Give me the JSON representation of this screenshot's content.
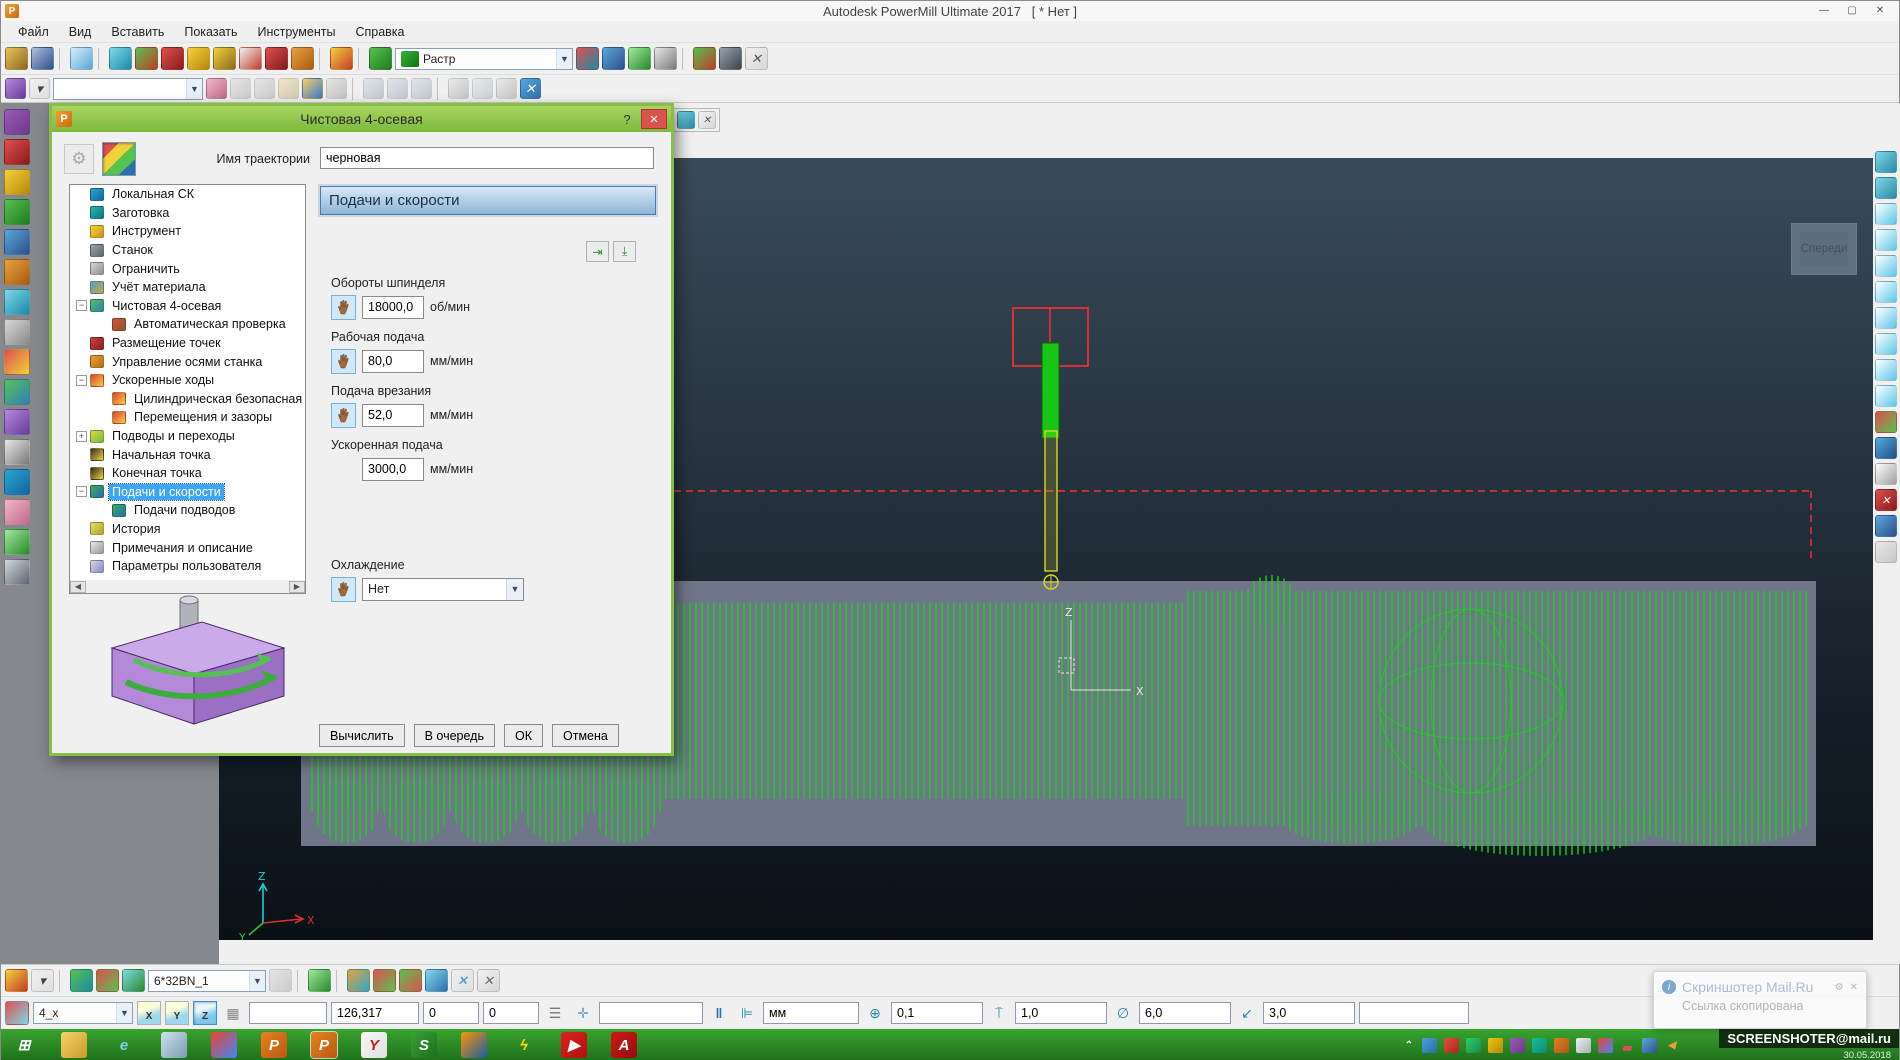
{
  "window": {
    "title": "Autodesk PowerMill Ultimate 2017",
    "title_suffix": "[ * Нет ]",
    "controls": {
      "minimize": "—",
      "maximize": "▢",
      "close": "✕"
    }
  },
  "menubar": {
    "items": [
      {
        "label": "Файл"
      },
      {
        "label": "Вид"
      },
      {
        "label": "Вставить"
      },
      {
        "label": "Показать"
      },
      {
        "label": "Инструменты"
      },
      {
        "label": "Справка"
      }
    ]
  },
  "toolbar_main": {
    "icons_left": [
      {
        "name": "open-project-icon",
        "c1": "#e8c35a",
        "c2": "#8a6a1f"
      },
      {
        "name": "save-project-icon",
        "c1": "#aebfd8",
        "c2": "#2f4f8f"
      },
      {
        "sep": true
      },
      {
        "name": "print-icon",
        "c1": "#d8eefc",
        "c2": "#58a8d8"
      },
      {
        "sep": true
      },
      {
        "name": "block-icon",
        "c1": "#7fd8e8",
        "c2": "#1a8aa8"
      },
      {
        "name": "create-toolpath-icon",
        "c1": "#58c24e",
        "c2": "#c43a2a"
      },
      {
        "name": "toolpath-edit-icon",
        "c1": "#e05050",
        "c2": "#8a1a1a"
      },
      {
        "name": "tool-icon",
        "c1": "#f2d23b",
        "c2": "#b8860b"
      },
      {
        "name": "tool-edit-icon",
        "c1": "#f2d23b",
        "c2": "#8a6a1f"
      },
      {
        "name": "pattern-icon",
        "c1": "#f0f0f0",
        "c2": "#c43a2a"
      },
      {
        "name": "points-icon",
        "c1": "#e05050",
        "c2": "#7e1a1a"
      },
      {
        "name": "boundary-icon",
        "c1": "#e8a23c",
        "c2": "#a85a14"
      },
      {
        "sep": true
      },
      {
        "name": "macro-icon",
        "c1": "#f2d23b",
        "c2": "#c43a2a"
      },
      {
        "sep": true
      },
      {
        "name": "simulation-icon",
        "c1": "#58c24e",
        "c2": "#1f7a1f"
      }
    ],
    "strategy_combo": {
      "value": "Растр",
      "icon_c1": "#35b435",
      "icon_c2": "#127012"
    },
    "icons_right": [
      {
        "name": "calculate-toolpath-icon",
        "c1": "#e05050",
        "c2": "#1a8aa8"
      },
      {
        "name": "statistics-icon",
        "c1": "#58a8d8",
        "c2": "#2f4f8f"
      },
      {
        "name": "nc-program-icon",
        "c1": "#9fe89f",
        "c2": "#2a8a2a"
      },
      {
        "name": "calculator-icon",
        "c1": "#e8e8e8",
        "c2": "#7a7a7a"
      },
      {
        "sep": true
      },
      {
        "name": "transform-icon",
        "c1": "#58c24e",
        "c2": "#c43a2a"
      },
      {
        "name": "find-icon",
        "c1": "#9aa4ad",
        "c2": "#3a444d"
      },
      {
        "name": "close-toolbar-icon",
        "glyph": "✕",
        "gc": "#555",
        "c1": "#f0f0f0",
        "c2": "#d8d8d8"
      }
    ]
  },
  "toolbar_second": {
    "icons_left": [
      {
        "name": "ncprogram-icon",
        "c1": "#b48ad8",
        "c2": "#6a3aa0"
      },
      {
        "name": "dropdown-arrow-icon",
        "glyph": "▾",
        "gc": "#444",
        "c1": "#f0f0f0",
        "c2": "#e0e0e0"
      }
    ],
    "combo_value": "",
    "icons_right": [
      {
        "name": "eraser-icon",
        "c1": "#f0b8c8",
        "c2": "#c06a8a"
      },
      {
        "name": "calc-nc-icon",
        "c1": "#d8d8d8",
        "c2": "#a0a0a0",
        "muted": true
      },
      {
        "name": "calc-all-icon",
        "c1": "#d8d8d8",
        "c2": "#a0a0a0",
        "muted": true
      },
      {
        "name": "levels-icon",
        "c1": "#e8d8a0",
        "c2": "#b0a060",
        "muted": true
      },
      {
        "name": "open-nc-icon",
        "c1": "#f4d06a",
        "c2": "#3a7ac8"
      },
      {
        "name": "save-nc-icon",
        "c1": "#d8d8d8",
        "c2": "#8a8a8a",
        "muted": true
      },
      {
        "sep": true
      },
      {
        "name": "workplane-a-icon",
        "c1": "#d0d8e0",
        "c2": "#8a98a8",
        "muted": true
      },
      {
        "name": "workplane-b-icon",
        "c1": "#d0d8e0",
        "c2": "#8a98a8",
        "muted": true
      },
      {
        "name": "workplane-c-icon",
        "c1": "#d0d8e0",
        "c2": "#8a98a8",
        "muted": true
      },
      {
        "sep": true
      },
      {
        "name": "grid-icon",
        "c1": "#e0e0e0",
        "c2": "#909090",
        "muted": true
      },
      {
        "name": "cloud-icon",
        "c1": "#e0e0e0",
        "c2": "#9ab0c0",
        "muted": true
      },
      {
        "name": "clip-icon",
        "c1": "#e0e0e0",
        "c2": "#909090",
        "muted": true
      },
      {
        "name": "close-second-toolbar-icon",
        "glyph": "✕",
        "gc": "#fff",
        "c1": "#58a8d8",
        "c2": "#2f6fae"
      }
    ]
  },
  "floating_fragment": {
    "icons": [
      {
        "name": "view-grid-icon",
        "c1": "#7fd8e8",
        "c2": "#2a8aa8"
      },
      {
        "name": "close-fragment-icon",
        "glyph": "✕",
        "gc": "#555",
        "c1": "#f0f0f0",
        "c2": "#d8d8d8"
      }
    ]
  },
  "left_toolbar": {
    "icons": [
      {
        "name": "explorer-purple-icon",
        "c1": "#9b59b6",
        "c2": "#6a3a8a"
      },
      {
        "name": "record-icon",
        "c1": "#e05050",
        "c2": "#8a1a1a"
      },
      {
        "name": "levels-manager-icon",
        "c1": "#f2d23b",
        "c2": "#b8860b"
      },
      {
        "name": "models-icon",
        "c1": "#58c24e",
        "c2": "#1f7a1f"
      },
      {
        "name": "workplane-tree-icon",
        "c1": "#58a8d8",
        "c2": "#2f4f8f"
      },
      {
        "name": "toolpath-tree-icon",
        "c1": "#e8a23c",
        "c2": "#a85a14"
      },
      {
        "name": "tools-tree-icon",
        "c1": "#7fd8e8",
        "c2": "#1a8aa8"
      },
      {
        "name": "boundary-tree-icon",
        "c1": "#d8d8d8",
        "c2": "#8a8a8a"
      },
      {
        "name": "pattern-tree-icon",
        "c1": "#e05050",
        "c2": "#f2d23b"
      },
      {
        "name": "feature-tree-icon",
        "c1": "#58c24e",
        "c2": "#2e7fc2"
      },
      {
        "name": "macro-tree-icon",
        "c1": "#b48ad8",
        "c2": "#6a3aa0"
      },
      {
        "name": "ncprogram-tree-icon",
        "c1": "#e8e8e8",
        "c2": "#7a7a7a"
      },
      {
        "name": "stock-model-icon",
        "c1": "#2aa7c9",
        "c2": "#1463a8"
      },
      {
        "name": "groups-icon",
        "c1": "#f0b8c8",
        "c2": "#c06a8a"
      },
      {
        "name": "simulation-tree-icon",
        "c1": "#9fe89f",
        "c2": "#2a8a2a"
      },
      {
        "name": "collision-icon",
        "c1": "#d0d8e0",
        "c2": "#5c666e"
      }
    ]
  },
  "right_toolbar": {
    "icons": [
      {
        "name": "view-table-icon",
        "c1": "#7fd8e8",
        "c2": "#2a8aa8"
      },
      {
        "name": "view-table2-icon",
        "c1": "#7fd8e8",
        "c2": "#2a8aa8"
      },
      {
        "name": "view-iso1-icon",
        "c1": "#ffffff",
        "c2": "#5bc8e8"
      },
      {
        "name": "view-iso2-icon",
        "c1": "#ffffff",
        "c2": "#5bc8e8"
      },
      {
        "name": "view-top-icon",
        "c1": "#ffffff",
        "c2": "#5bc8e8"
      },
      {
        "name": "view-front-icon",
        "c1": "#ffffff",
        "c2": "#5bc8e8"
      },
      {
        "name": "view-side-icon",
        "c1": "#ffffff",
        "c2": "#5bc8e8"
      },
      {
        "name": "view-back-icon",
        "c1": "#ffffff",
        "c2": "#5bc8e8"
      },
      {
        "name": "view-bottom-icon",
        "c1": "#ffffff",
        "c2": "#5bc8e8"
      },
      {
        "name": "view-iso3-icon",
        "c1": "#ffffff",
        "c2": "#5bc8e8"
      },
      {
        "name": "shade-toggle-icon",
        "c1": "#e05050",
        "c2": "#58c24e"
      },
      {
        "name": "globe-icon",
        "c1": "#58a8d8",
        "c2": "#1f4f8f"
      },
      {
        "name": "page-icon",
        "c1": "#ffffff",
        "c2": "#a0a0a0"
      },
      {
        "name": "close-view-icon",
        "glyph": "✕",
        "gc": "#fff",
        "c1": "#e05050",
        "c2": "#8a1a1a"
      },
      {
        "name": "cursor-arrow-icon",
        "c1": "#58a8d8",
        "c2": "#2f4f8f"
      },
      {
        "name": "blank-slot-icon",
        "c1": "#e8e8e8",
        "c2": "#c8c8c8"
      }
    ]
  },
  "dialog": {
    "title": "Чистовая 4-осевая",
    "help_label": "?",
    "close_label": "✕",
    "name_label": "Имя траектории",
    "name_value": "черновая",
    "tree": [
      {
        "label": "Локальная СК",
        "pad": 6,
        "exp": "",
        "c1": "#2aa7c9",
        "c2": "#1463a8"
      },
      {
        "label": "Заготовка",
        "pad": 6,
        "exp": "",
        "c1": "#27b3b0",
        "c2": "#0e7a7a"
      },
      {
        "label": "Инструмент",
        "pad": 6,
        "exp": "",
        "c1": "#f2d23b",
        "c2": "#c9961c"
      },
      {
        "label": "Станок",
        "pad": 6,
        "exp": "",
        "c1": "#9aa4ad",
        "c2": "#5c666e"
      },
      {
        "label": "Ограничить",
        "pad": 6,
        "exp": "",
        "c1": "#cfd6da",
        "c2": "#8a9298"
      },
      {
        "label": "Учёт материала",
        "pad": 6,
        "exp": "",
        "c1": "#4f9fd9",
        "c2": "#caa63c"
      },
      {
        "label": "Чистовая 4-осевая",
        "pad": 6,
        "exp": "−",
        "c1": "#58c24e",
        "c2": "#2e7fc2"
      },
      {
        "label": "Автоматическая проверка",
        "pad": 28,
        "exp": "",
        "c1": "#d94f3f",
        "c2": "#8a5a2a"
      },
      {
        "label": "Размещение точек",
        "pad": 6,
        "exp": "",
        "c1": "#d43c3c",
        "c2": "#7e2222"
      },
      {
        "label": "Управление осями станка",
        "pad": 6,
        "exp": "",
        "c1": "#e8a23c",
        "c2": "#b86a14"
      },
      {
        "label": "Ускоренные ходы",
        "pad": 6,
        "exp": "−",
        "c1": "#e03c3c",
        "c2": "#f2d23b"
      },
      {
        "label": "Цилиндрическая безопасная об",
        "pad": 28,
        "exp": "",
        "c1": "#e03c3c",
        "c2": "#f2d23b"
      },
      {
        "label": "Перемещения и зазоры",
        "pad": 28,
        "exp": "",
        "c1": "#e03c3c",
        "c2": "#f2d23b"
      },
      {
        "label": "Подводы и переходы",
        "pad": 6,
        "exp": "+",
        "c1": "#f2d23b",
        "c2": "#58c24e"
      },
      {
        "label": "Начальная точка",
        "pad": 6,
        "exp": "",
        "c1": "#2b2b2b",
        "c2": "#f2d23b"
      },
      {
        "label": "Конечная точка",
        "pad": 6,
        "exp": "",
        "c1": "#2b2b2b",
        "c2": "#f2d23b"
      },
      {
        "label": "Подачи и скорости",
        "pad": 6,
        "exp": "−",
        "sel": true,
        "c1": "#3fae49",
        "c2": "#1f6fbf"
      },
      {
        "label": "Подачи подводов",
        "pad": 28,
        "exp": "",
        "c1": "#3fae49",
        "c2": "#1f6fbf"
      },
      {
        "label": "История",
        "pad": 6,
        "exp": "",
        "c1": "#e8dc66",
        "c2": "#b0a42c"
      },
      {
        "label": "Примечания и описание",
        "pad": 6,
        "exp": "",
        "c1": "#e8e8e8",
        "c2": "#9a9a9a"
      },
      {
        "label": "Параметры пользователя",
        "pad": 6,
        "exp": "",
        "c1": "#d9d9d9",
        "c2": "#8888cc"
      }
    ],
    "page": {
      "header": "Подачи и скорости",
      "fields": [
        {
          "label": "Обороты шпинделя",
          "value": "18000,0",
          "unit": "об/мин",
          "hand": true
        },
        {
          "label": "Рабочая подача",
          "value": "80,0",
          "unit": "мм/мин",
          "hand": true
        },
        {
          "label": "Подача врезания",
          "value": "52,0",
          "unit": "мм/мин",
          "hand": true
        },
        {
          "label": "Ускоренная подача",
          "value": "3000,0",
          "unit": "мм/мин",
          "hand": false
        }
      ],
      "cooling": {
        "label": "Охлаждение",
        "value": "Нет",
        "hand": true
      }
    },
    "buttons": [
      {
        "label": "Вычислить",
        "name": "calculate-button"
      },
      {
        "label": "В очередь",
        "name": "queue-button"
      },
      {
        "label": "ОК",
        "name": "ok-button"
      },
      {
        "label": "Отмена",
        "name": "cancel-button"
      }
    ]
  },
  "viewport": {
    "view_label": "Спереди",
    "axes": {
      "x": "X",
      "y": "Y",
      "z": "Z"
    },
    "colors": {
      "wire": "#1ad11a",
      "dash": "#ff3030",
      "slab": "#6f7689"
    }
  },
  "tool_toolbar": {
    "tool_name": "6*32BN_1",
    "icons_left": [
      {
        "name": "tool-create-icon",
        "c1": "#f2d23b",
        "c2": "#c43a2a"
      },
      {
        "name": "tool-dropdown-icon",
        "glyph": "▾",
        "gc": "#444",
        "c1": "#f0f0f0",
        "c2": "#e0e0e0"
      },
      {
        "sep": true
      },
      {
        "name": "tool-shade-icon",
        "c1": "#58c24e",
        "c2": "#1a8aa8"
      },
      {
        "name": "tool-axis-icon",
        "c1": "#e05050",
        "c2": "#58c24e"
      },
      {
        "name": "tool-outline-icon",
        "c1": "#7fd8e8",
        "c2": "#2a8a2a"
      }
    ],
    "icons_right": [
      {
        "name": "tool-stack-icon",
        "c1": "#d8d8d8",
        "c2": "#a0a0a0",
        "muted": true
      },
      {
        "sep": true
      },
      {
        "name": "tool-rotate-icon",
        "c1": "#9fe89f",
        "c2": "#2a8a2a"
      },
      {
        "sep": true
      },
      {
        "name": "position-axes-icon",
        "c1": "#e8a23c",
        "c2": "#2aa7c9"
      },
      {
        "name": "shade-sphere-icon",
        "c1": "#e05050",
        "c2": "#58c24e"
      },
      {
        "name": "shade-sphere2-icon",
        "c1": "#58c24e",
        "c2": "#e05050"
      },
      {
        "name": "draw-toggle-icon",
        "c1": "#7fd8e8",
        "c2": "#2f6fae"
      },
      {
        "name": "blue-x-icon",
        "glyph": "✕",
        "gc": "#2f8fdf",
        "c1": "#f0f0f0",
        "c2": "#e0e0e0"
      },
      {
        "name": "close-tool-toolbar-icon",
        "glyph": "✕",
        "gc": "#666",
        "c1": "#f0f0f0",
        "c2": "#d8d8d8"
      }
    ]
  },
  "statusbar": {
    "workplane_value": "4_x",
    "axis_x": "X",
    "axis_y": "Y",
    "axis_z": "Z",
    "blank1": "",
    "pos_x": "126,317",
    "pos_y": "0",
    "pos_z": "0",
    "blank2": "",
    "units": "мм",
    "tolerance": "0,1",
    "thickness": "1,0",
    "diameter": "6,0",
    "stepover": "3,0",
    "blank3": ""
  },
  "taskbar": {
    "apps": [
      {
        "name": "taskbar-start-button",
        "glyph": "⊞",
        "gc": "#ffffff"
      },
      {
        "name": "taskbar-explorer-icon",
        "c1": "#f6d36a",
        "c2": "#c89a2a"
      },
      {
        "name": "taskbar-ie-icon",
        "glyph": "e",
        "gc": "#7ad0f5"
      },
      {
        "name": "taskbar-calculator-icon",
        "c1": "#cfe3ee",
        "c2": "#7a9ab0"
      },
      {
        "name": "taskbar-chrome-icon",
        "c1": "#ea4335",
        "c2": "#4285f4",
        "circ": true
      },
      {
        "name": "taskbar-powermill-icon",
        "glyph": "P",
        "gc": "#ffffff",
        "c1": "#e8801e",
        "c2": "#b85a10"
      },
      {
        "name": "taskbar-powermill-active-icon",
        "glyph": "P",
        "gc": "#ffffff",
        "c1": "#e8801e",
        "c2": "#b85a10",
        "active": true
      },
      {
        "name": "taskbar-yandex-icon",
        "glyph": "Y",
        "gc": "#d01818",
        "c1": "#f8f8f8",
        "c2": "#e0e0e0"
      },
      {
        "name": "taskbar-green-s-icon",
        "glyph": "S",
        "gc": "#ffffff",
        "c1": "#3aa03a",
        "c2": "#1a701a"
      },
      {
        "name": "taskbar-firefox-icon",
        "c1": "#ff9500",
        "c2": "#1a5aa8",
        "circ": true
      },
      {
        "name": "taskbar-lightning-icon",
        "glyph": "ϟ",
        "gc": "#ffd400"
      },
      {
        "name": "taskbar-youtube-icon",
        "glyph": "▶",
        "gc": "#ffffff",
        "c1": "#e02020",
        "c2": "#b01010"
      },
      {
        "name": "taskbar-pdf-icon",
        "glyph": "A",
        "gc": "#ffffff",
        "c1": "#d01818",
        "c2": "#901010"
      }
    ],
    "tray": [
      {
        "name": "tray-chevron-icon",
        "glyph": "⌃",
        "gc": "#ffffff"
      },
      {
        "name": "tray-app1-icon",
        "c1": "#4aa3df",
        "c2": "#2a6aa0"
      },
      {
        "name": "tray-app2-icon",
        "c1": "#e74c3c",
        "c2": "#a02a1f"
      },
      {
        "name": "tray-app3-icon",
        "c1": "#2ecc71",
        "c2": "#1a8a48"
      },
      {
        "name": "tray-app4-icon",
        "c1": "#f1c40f",
        "c2": "#b08a08"
      },
      {
        "name": "tray-app5-icon",
        "c1": "#9b59b6",
        "c2": "#6a3a8a"
      },
      {
        "name": "tray-app6-icon",
        "c1": "#1abc9c",
        "c2": "#0e8a70"
      },
      {
        "name": "tray-app7-icon",
        "c1": "#e67e22",
        "c2": "#a85a14"
      },
      {
        "name": "tray-app8-icon",
        "c1": "#ecf0f1",
        "c2": "#a8b0b4"
      },
      {
        "name": "tray-chrome-icon",
        "c1": "#ea4335",
        "c2": "#4285f4",
        "circ": true
      },
      {
        "name": "tray-network-icon",
        "glyph": "▃",
        "gc": "#e05050"
      },
      {
        "name": "tray-display-icon",
        "c1": "#58a8d8",
        "c2": "#2f4f8f"
      },
      {
        "name": "tray-volume-icon",
        "glyph": "◀",
        "gc": "#e8a23c"
      }
    ],
    "watermark": {
      "text": "SCREENSHOTER@mail.ru",
      "date": "30.05.2018"
    }
  },
  "notification": {
    "info_glyph": "i",
    "title": "Скриншотер Mail.Ru",
    "settings_glyph": "⚙",
    "close_glyph": "✕",
    "message": "Ссылка скопирована"
  }
}
